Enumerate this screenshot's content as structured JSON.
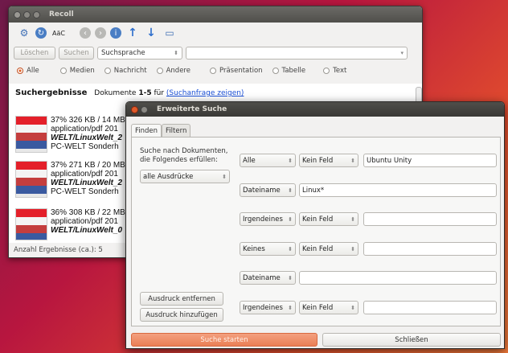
{
  "main_window": {
    "title": "Recoll",
    "toolbar": {
      "icons": [
        "settings-icon",
        "refresh-icon",
        "spelling-icon",
        "back-icon",
        "forward-icon",
        "info-icon",
        "arrow-up-icon",
        "arrow-down-icon",
        "window-icon"
      ],
      "spelling_label": "AäC"
    },
    "search_row": {
      "clear_label": "Löschen",
      "search_label": "Suchen",
      "mode_value": "Suchsprache",
      "query_value": ""
    },
    "filters": [
      "Alle",
      "Medien",
      "Nachricht",
      "Andere",
      "Präsentation",
      "Tabelle",
      "Text"
    ],
    "filters_selected": "Alle",
    "results_header": {
      "title": "Suchergebnisse",
      "docs_text": "Dokumente",
      "range": "1-5",
      "for_text": "für",
      "link": "(Suchanfrage zeigen)"
    },
    "results": [
      {
        "line1": "37% 326 KB / 14 MB",
        "line2": "application/pdf 201",
        "line3": "WELT/LinuxWelt_2",
        "line4": "PC-WELT Sonderh"
      },
      {
        "line1": "37% 271 KB / 20 MB",
        "line2": "application/pdf 201",
        "line3": "WELT/LinuxWelt_2",
        "line4": "PC-WELT Sonderh"
      },
      {
        "line1": "36% 308 KB / 22 MB",
        "line2": "application/pdf 201",
        "line3": "WELT/LinuxWelt_0",
        "line4": ""
      }
    ],
    "status": "Anzahl Ergebnisse (ca.): 5"
  },
  "dialog": {
    "title": "Erweiterte Suche",
    "tabs": [
      "Finden",
      "Filtern"
    ],
    "intro_label_1": "Suche nach Dokumenten,",
    "intro_label_2": "die Folgendes erfüllen:",
    "match_mode": "alle Ausdrücke",
    "clauses": [
      {
        "type": "Alle",
        "field": "Kein Feld",
        "value": "Ubuntu Unity"
      },
      {
        "type": "Dateiname",
        "field": "",
        "value": "Linux*"
      },
      {
        "type": "Irgendeines",
        "field": "Kein Feld",
        "value": ""
      },
      {
        "type": "Keines",
        "field": "Kein Feld",
        "value": ""
      },
      {
        "type": "Dateiname",
        "field": "",
        "value": ""
      },
      {
        "type": "Irgendeines",
        "field": "Kein Feld",
        "value": ""
      }
    ],
    "remove_label": "Ausdruck entfernen",
    "add_label": "Ausdruck hinzufügen",
    "start_label": "Suche starten",
    "close_label": "Schließen"
  }
}
